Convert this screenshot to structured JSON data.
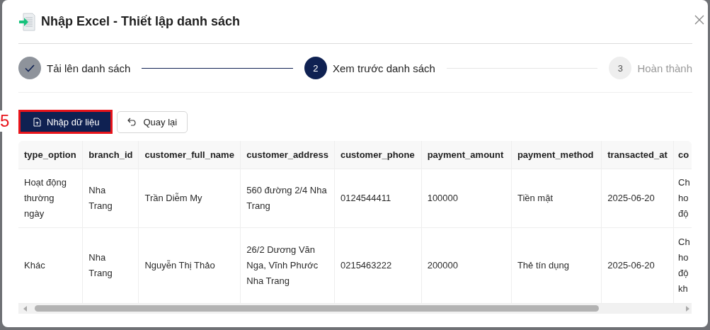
{
  "dialog": {
    "title": "Nhập Excel - Thiết lập danh sách"
  },
  "steps": [
    {
      "label": "Tải lên danh sách",
      "completed": true,
      "selected": false
    },
    {
      "number": "2",
      "label": "Xem trước danh sách",
      "completed": false,
      "selected": true
    },
    {
      "number": "3",
      "label": "Hoàn thành",
      "completed": false,
      "selected": false
    }
  ],
  "annotation": {
    "label": "5"
  },
  "buttons": [
    {
      "label": "Nhập dữ liệu",
      "kind": "primary",
      "highlighted": true
    },
    {
      "label": "Quay lại",
      "kind": "secondary",
      "highlighted": false
    }
  ],
  "table": {
    "columns": [
      "type_option",
      "branch_id",
      "customer_full_name",
      "customer_address",
      "customer_phone",
      "payment_amount",
      "payment_method",
      "transacted_at",
      "co"
    ],
    "rows": [
      [
        "Hoạt động thường ngày",
        "Nha Trang",
        "Trần Diễm My",
        "560 đường 2/4 Nha Trang",
        "0124544411",
        "100000",
        "Tiền mặt",
        "2025-06-20",
        "Ch ho độ"
      ],
      [
        "Khác",
        "Nha Trang",
        "Nguyễn Thị Thảo",
        "26/2 Dương Văn Nga, Vĩnh Phước Nha Trang",
        "0215463222",
        "200000",
        "Thẻ tín dụng",
        "2025-06-20",
        "Ch ho độ kh"
      ]
    ]
  }
}
